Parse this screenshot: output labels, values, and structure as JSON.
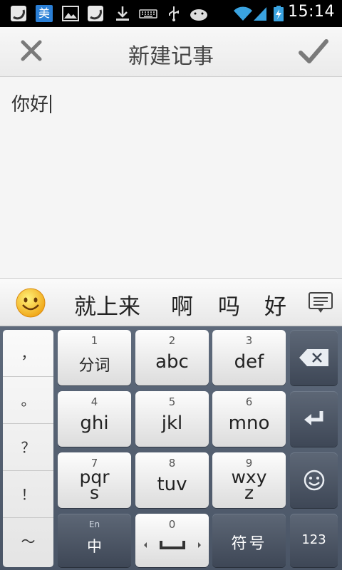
{
  "status_bar": {
    "time": "15:14",
    "icons": [
      "watermelon-icon",
      "meituan-icon",
      "image-icon",
      "watermelon-icon",
      "download-icon",
      "keyboard-icon",
      "usb-icon",
      "android-icon",
      "wifi-icon",
      "signal-icon",
      "battery-charging-icon"
    ],
    "meituan_label": "美"
  },
  "header": {
    "title": "新建记事",
    "close_icon": "close-icon",
    "confirm_icon": "check-icon"
  },
  "editor": {
    "text": "你好"
  },
  "candidates": {
    "emoji_icon": "smiley-icon",
    "items": [
      "就上来",
      "啊",
      "吗",
      "好"
    ],
    "menu_icon": "candidate-list-icon"
  },
  "keyboard": {
    "punctuation": [
      "，",
      "。",
      "？",
      "！",
      "～"
    ],
    "keys": [
      {
        "num": "1",
        "label": "分词"
      },
      {
        "num": "2",
        "label": "abc"
      },
      {
        "num": "3",
        "label": "def"
      },
      {
        "num": "4",
        "label": "ghi"
      },
      {
        "num": "5",
        "label": "jkl"
      },
      {
        "num": "6",
        "label": "mno"
      },
      {
        "num": "7",
        "label": "pqrs"
      },
      {
        "num": "8",
        "label": "tuv"
      },
      {
        "num": "9",
        "label": "wxyz"
      },
      {
        "num": "0",
        "label": "space"
      }
    ],
    "key7_lines": [
      "pqr",
      "s"
    ],
    "key9_lines": [
      "wxy",
      "z"
    ],
    "lang_key": {
      "small": "En",
      "label": "中"
    },
    "symbol_key": "符号",
    "num_key": "123",
    "backspace_icon": "backspace-icon",
    "enter_icon": "enter-icon",
    "emoji_key_icon": "smiley-face-icon"
  }
}
